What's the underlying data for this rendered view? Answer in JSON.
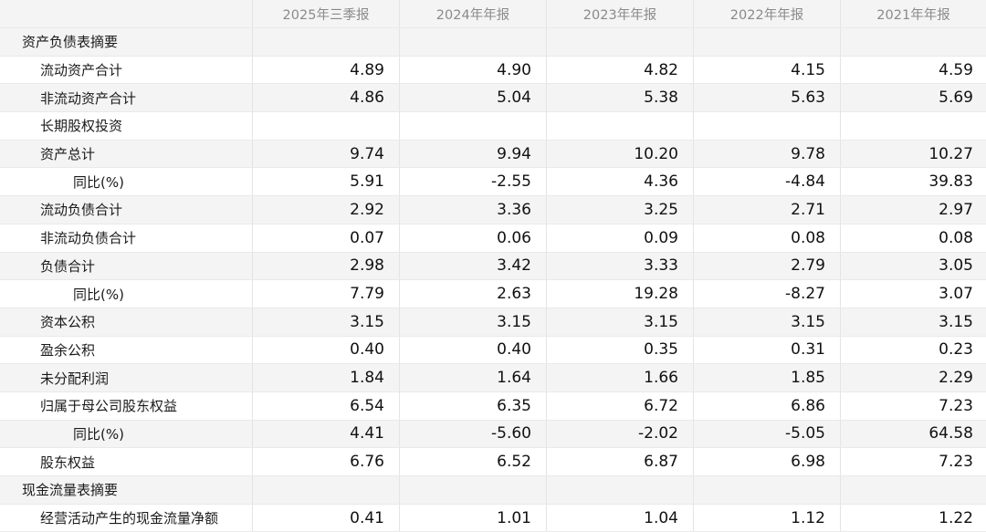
{
  "columns": [
    "2025年三季报",
    "2024年年报",
    "2023年年报",
    "2022年年报",
    "2021年年报"
  ],
  "rows": [
    {
      "label": "资产负债表摘要",
      "kind": "section",
      "values": [
        "",
        "",
        "",
        "",
        ""
      ]
    },
    {
      "label": "流动资产合计",
      "kind": "item",
      "values": [
        "4.89",
        "4.90",
        "4.82",
        "4.15",
        "4.59"
      ]
    },
    {
      "label": "非流动资产合计",
      "kind": "item",
      "values": [
        "4.86",
        "5.04",
        "5.38",
        "5.63",
        "5.69"
      ]
    },
    {
      "label": "长期股权投资",
      "kind": "item",
      "values": [
        "",
        "",
        "",
        "",
        ""
      ]
    },
    {
      "label": "资产总计",
      "kind": "item",
      "values": [
        "9.74",
        "9.94",
        "10.20",
        "9.78",
        "10.27"
      ]
    },
    {
      "label": "同比(%)",
      "kind": "sub",
      "values": [
        "5.91",
        "-2.55",
        "4.36",
        "-4.84",
        "39.83"
      ]
    },
    {
      "label": "流动负债合计",
      "kind": "item",
      "values": [
        "2.92",
        "3.36",
        "3.25",
        "2.71",
        "2.97"
      ]
    },
    {
      "label": "非流动负债合计",
      "kind": "item",
      "values": [
        "0.07",
        "0.06",
        "0.09",
        "0.08",
        "0.08"
      ]
    },
    {
      "label": "负债合计",
      "kind": "item",
      "values": [
        "2.98",
        "3.42",
        "3.33",
        "2.79",
        "3.05"
      ]
    },
    {
      "label": "同比(%)",
      "kind": "sub",
      "values": [
        "7.79",
        "2.63",
        "19.28",
        "-8.27",
        "3.07"
      ]
    },
    {
      "label": "资本公积",
      "kind": "item",
      "values": [
        "3.15",
        "3.15",
        "3.15",
        "3.15",
        "3.15"
      ]
    },
    {
      "label": "盈余公积",
      "kind": "item",
      "values": [
        "0.40",
        "0.40",
        "0.35",
        "0.31",
        "0.23"
      ]
    },
    {
      "label": "未分配利润",
      "kind": "item",
      "values": [
        "1.84",
        "1.64",
        "1.66",
        "1.85",
        "2.29"
      ]
    },
    {
      "label": "归属于母公司股东权益",
      "kind": "item",
      "values": [
        "6.54",
        "6.35",
        "6.72",
        "6.86",
        "7.23"
      ]
    },
    {
      "label": "同比(%)",
      "kind": "sub",
      "values": [
        "4.41",
        "-5.60",
        "-2.02",
        "-5.05",
        "64.58"
      ]
    },
    {
      "label": "股东权益",
      "kind": "item",
      "values": [
        "6.76",
        "6.52",
        "6.87",
        "6.98",
        "7.23"
      ]
    },
    {
      "label": "现金流量表摘要",
      "kind": "section",
      "values": [
        "",
        "",
        "",
        "",
        ""
      ]
    },
    {
      "label": "经营活动产生的现金流量净额",
      "kind": "item",
      "values": [
        "0.41",
        "1.01",
        "1.04",
        "1.12",
        "1.22"
      ]
    }
  ],
  "colors": {
    "negative": "#e8403a",
    "stripe": "#f4f4f4"
  }
}
